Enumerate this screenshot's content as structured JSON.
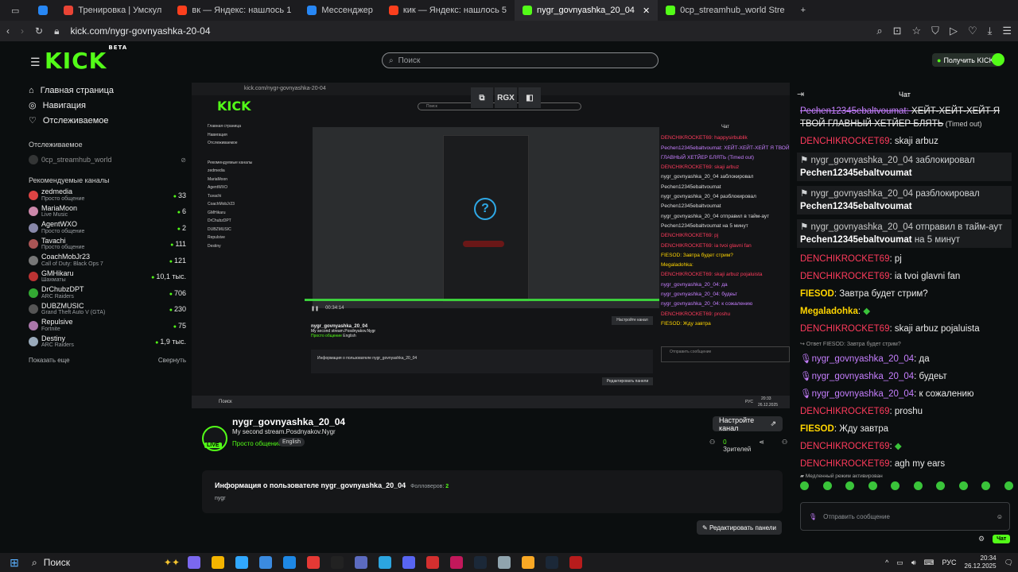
{
  "browser": {
    "tabs": [
      {
        "label": "Тренировка | Умскул",
        "color": "#e94435"
      },
      {
        "label": "вк — Яндекс: нашлось 1",
        "color": "#fc3f1d"
      },
      {
        "label": "Мессенджер",
        "color": "#2787f5"
      },
      {
        "label": "кик — Яндекс: нашлось 5",
        "color": "#fc3f1d"
      },
      {
        "label": "nygr_govnyashka_20_04",
        "color": "#53fc18"
      },
      {
        "label": "0cp_streamhub_world Stre",
        "color": "#53fc18"
      }
    ],
    "url": "kick.com/nygr-govnyashka-20-04"
  },
  "header": {
    "logo": "KICK",
    "logo_beta": "BETA",
    "search_placeholder": "Поиск",
    "get_kicks": "Получить KICKs"
  },
  "sidebar": {
    "nav": [
      "Главная страница",
      "Навигация",
      "Отслеживаемое"
    ],
    "followed_title": "Отслеживаемое",
    "followed": {
      "name": "0cp_streamhub_world"
    },
    "recommended_title": "Рекомендуемые каналы",
    "channels": [
      {
        "name": "zedmedia",
        "category": "Просто общение",
        "count": "33",
        "color": "#d44"
      },
      {
        "name": "MariaMoon",
        "category": "Live Music",
        "count": "6",
        "color": "#c8a"
      },
      {
        "name": "AgentWXO",
        "category": "Просто общение",
        "count": "2",
        "color": "#88a"
      },
      {
        "name": "Tavachi",
        "category": "Просто общение",
        "count": "111",
        "color": "#a55"
      },
      {
        "name": "CoachMobJr23",
        "category": "Call of Duty: Black Ops 7",
        "count": "121",
        "color": "#777"
      },
      {
        "name": "GMHikaru",
        "category": "Шахматы",
        "count": "10,1 тыс.",
        "color": "#b33"
      },
      {
        "name": "DrChubzDPT",
        "category": "ARC Raiders",
        "count": "706",
        "color": "#3a3"
      },
      {
        "name": "DUBZMUSIC",
        "category": "Grand Theft Auto V (GTA)",
        "count": "230",
        "color": "#555"
      },
      {
        "name": "Repulsive",
        "category": "Fortnite",
        "count": "75",
        "color": "#a7a"
      },
      {
        "name": "Destiny",
        "category": "ARC Raiders",
        "count": "1,9 тыс.",
        "color": "#9ab"
      }
    ],
    "show_more": "Показать еще",
    "collapse": "Свернуть"
  },
  "player": {
    "overlay_label": "RGX",
    "nested": {
      "url": "kick.com/nygr-govnyashka-20-04",
      "search": "Поиск",
      "get_kicks": "Получить KICKs",
      "nav": [
        "Главная страница",
        "Навигация",
        "Отслеживаемое"
      ],
      "recommended_title": "Рекомендуемые каналы",
      "channel_names": [
        "zedmedia",
        "MariaMoon",
        "AgentWXO",
        "Tuvachi",
        "CoachMobJr23",
        "GMHikaru",
        "DrChubzDPT",
        "DUBZMUSIC",
        "Repulsive",
        "Destiny"
      ],
      "time": "00:34:14",
      "streamer": "nygr_govnyashka_20_04",
      "stream_title": "My second stream.Posdnyakov.Nygr",
      "category": "Просто общение",
      "lang": "English",
      "tune": "Настройте канал",
      "about": "Информация о пользователе nygr_govnyashka_20_04",
      "edit": "Редактировать панели",
      "taskbar_search": "Поиск",
      "taskbar_lang": "РУС",
      "taskbar_time": "20:33",
      "taskbar_date": "26.12.2025",
      "chat_title": "Чат",
      "chat_lines": [
        {
          "cls": "r",
          "text": "DENCHIKROCKET69: happysirbublik"
        },
        {
          "cls": "p",
          "text": "Pechen12345ebaltvoumat: ХЕЙТ-ХЕЙТ-ХЕЙТ Я ТВОЙ ГЛАВНЫЙ ХЕТЙЕР БЛЯТЬ (Timed out)"
        },
        {
          "cls": "r",
          "text": "DENCHIKROCKET69: skaji arbuz"
        },
        {
          "cls": "",
          "text": "nygr_govnyashka_20_04 заблокировал Pechen12345ebaltvoumat"
        },
        {
          "cls": "",
          "text": "nygr_govnyashka_20_04 разблокировал Pechen12345ebaltvoumat"
        },
        {
          "cls": "",
          "text": "nygr_govnyashka_20_04 отправил в тайм-аут Pechen12345ebaltvoumat на 5 минут"
        },
        {
          "cls": "r",
          "text": "DENCHIKROCKET69: pj"
        },
        {
          "cls": "r",
          "text": "DENCHIKROCKET69: ia tvoi glavni fan"
        },
        {
          "cls": "y",
          "text": "FIESOD: Завтра будет стрим?"
        },
        {
          "cls": "y",
          "text": "Megaladohka:"
        },
        {
          "cls": "r",
          "text": "DENCHIKROCKET69: skaji arbuz pojaluista"
        },
        {
          "cls": "p",
          "text": "nygr_govnyashka_20_04: да"
        },
        {
          "cls": "p",
          "text": "nygr_govnyashka_20_04: будеьт"
        },
        {
          "cls": "p",
          "text": "nygr_govnyashka_20_04: к сожалению"
        },
        {
          "cls": "r",
          "text": "DENCHIKROCKET69: proshu"
        },
        {
          "cls": "y",
          "text": "FIESOD: Жду завтра"
        }
      ],
      "chat_input": "Отправить сообщение"
    }
  },
  "stream": {
    "streamer": "nygr_govnyashka_20_04",
    "title": "My second stream.Posdnyakov.Nygr",
    "category": "Просто общение",
    "language": "English",
    "live": "LIVE",
    "tune_channel": "Настройте канал",
    "viewers": "0",
    "viewers_label": "Зрителей"
  },
  "about": {
    "heading": "Информация о пользователе nygr_govnyashka_20_04",
    "followers_label": "Фолловеров:",
    "followers": "2",
    "bio": "nygr"
  },
  "edit_panels": "Редактировать панели",
  "chat": {
    "title": "Чат",
    "messages": [
      {
        "type": "timedout",
        "user": "Pechen12345ebaltvoumat",
        "text": "ХЕЙТ-ХЕЙТ-ХЕЙТ Я ТВОЙ ГЛАВНЫЙ ХЕТЙЕР БЛЯТЬ",
        "suffix": "(Timed out)"
      },
      {
        "type": "msg",
        "ucls": "u-red",
        "user": "DENCHIKROCKET69",
        "text": "skaji arbuz"
      },
      {
        "type": "sys",
        "user": "nygr_govnyashka_20_04",
        "action": "заблокировал",
        "target": "Pechen12345ebaltvoumat"
      },
      {
        "type": "sys",
        "user": "nygr_govnyashka_20_04",
        "action": "разблокировал",
        "target": "Pechen12345ebaltvoumat"
      },
      {
        "type": "sys",
        "user": "nygr_govnyashka_20_04",
        "action": "отправил в тайм-аут",
        "target": "Pechen12345ebaltvoumat",
        "after": "на 5 минут"
      },
      {
        "type": "msg",
        "ucls": "u-red",
        "user": "DENCHIKROCKET69",
        "text": "pj"
      },
      {
        "type": "msg",
        "ucls": "u-red",
        "user": "DENCHIKROCKET69",
        "text": "ia tvoi glavni fan"
      },
      {
        "type": "msg",
        "ucls": "u-yel",
        "user": "FIESOD",
        "text": "Завтра будет стрим?"
      },
      {
        "type": "msg",
        "ucls": "u-yel",
        "user": "Megaladohka",
        "text": "",
        "emote": true
      },
      {
        "type": "msg",
        "ucls": "u-red",
        "user": "DENCHIKROCKET69",
        "text": "skaji arbuz pojaluista"
      },
      {
        "type": "msg",
        "ucls": "u-purp",
        "user": "nygr_govnyashka_20_04",
        "text": "да",
        "reply": "Ответ FIESOD: Завтра будет стрим?",
        "mic": true
      },
      {
        "type": "msg",
        "ucls": "u-purp",
        "user": "nygr_govnyashka_20_04",
        "text": "будеьт",
        "mic": true
      },
      {
        "type": "msg",
        "ucls": "u-purp",
        "user": "nygr_govnyashka_20_04",
        "text": "к сожалению",
        "mic": true
      },
      {
        "type": "msg",
        "ucls": "u-red",
        "user": "DENCHIKROCKET69",
        "text": "proshu"
      },
      {
        "type": "msg",
        "ucls": "u-yel",
        "user": "FIESOD",
        "text": "Жду завтра"
      },
      {
        "type": "msg",
        "ucls": "u-red",
        "user": "DENCHIKROCKET69",
        "text": "",
        "emote": true
      },
      {
        "type": "msg",
        "ucls": "u-red",
        "user": "DENCHIKROCKET69",
        "text": "agh my ears"
      }
    ],
    "slow_mode": "Медленный режим активирован",
    "input_placeholder": "Отправить сообщение",
    "send": "Чат"
  },
  "taskbar": {
    "search": "Поиск",
    "lang": "РУС",
    "time": "20:34",
    "date": "26.12.2025",
    "app_colors": [
      "#7b68ee",
      "#f4b400",
      "#31a8ff",
      "#3b8be0",
      "#1e88e5",
      "#e53935",
      "#222",
      "#5c6bc0",
      "#2ca5e0",
      "#5865f2",
      "#d32f2f",
      "#c2185b",
      "#1b2838",
      "#90a4ae",
      "#f9a825",
      "#1b2838",
      "#b71c1c"
    ]
  },
  "colors": {
    "accent": "#53fc18",
    "red_user": "#ff3b5c",
    "purple_user": "#c67fff",
    "yellow_user": "#ffd500"
  }
}
